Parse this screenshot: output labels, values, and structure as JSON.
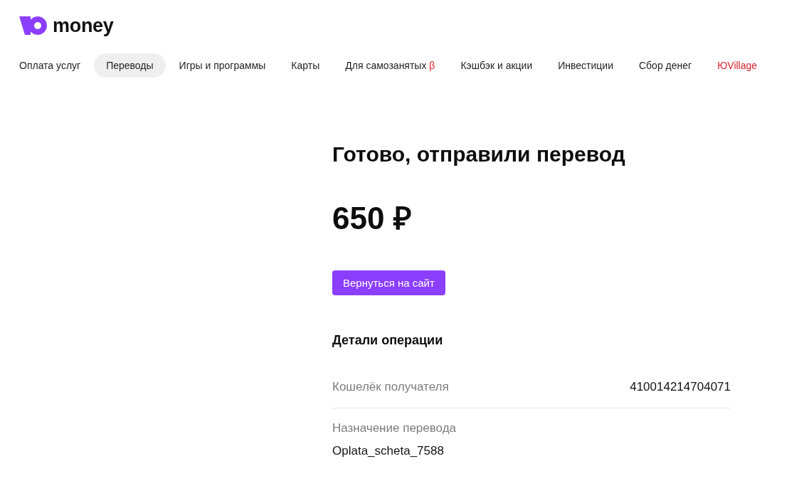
{
  "header": {
    "logo_text": "money"
  },
  "nav": [
    {
      "label": "Оплата услуг",
      "selected": false,
      "color": "#1f1f1f"
    },
    {
      "label": "Переводы",
      "selected": true,
      "color": "#1f1f1f"
    },
    {
      "label": "Игры и программы",
      "selected": false,
      "color": "#1f1f1f"
    },
    {
      "label": "Карты",
      "selected": false,
      "color": "#1f1f1f"
    },
    {
      "label": "Для самозанятых",
      "badge": "β",
      "selected": false,
      "color": "#1f1f1f"
    },
    {
      "label": "Кэшбэк и акции",
      "selected": false,
      "color": "#1f1f1f"
    },
    {
      "label": "Инвестиции",
      "selected": false,
      "color": "#1f1f1f"
    },
    {
      "label": "Сбор денег",
      "selected": false,
      "color": "#1f1f1f"
    },
    {
      "label": "ЮVillage",
      "selected": false,
      "color": "#d6242f"
    }
  ],
  "result": {
    "title": "Готово, отправили перевод",
    "amount": "650 ₽",
    "button": "Вернуться на сайт"
  },
  "details": {
    "title": "Детали операции",
    "rows": [
      {
        "kind": "inline",
        "label": "Кошелёк получателя",
        "value": "410014214704071"
      },
      {
        "kind": "stacked",
        "label": "Назначение перевода",
        "value": "Oplata_scheta_7588"
      }
    ]
  }
}
